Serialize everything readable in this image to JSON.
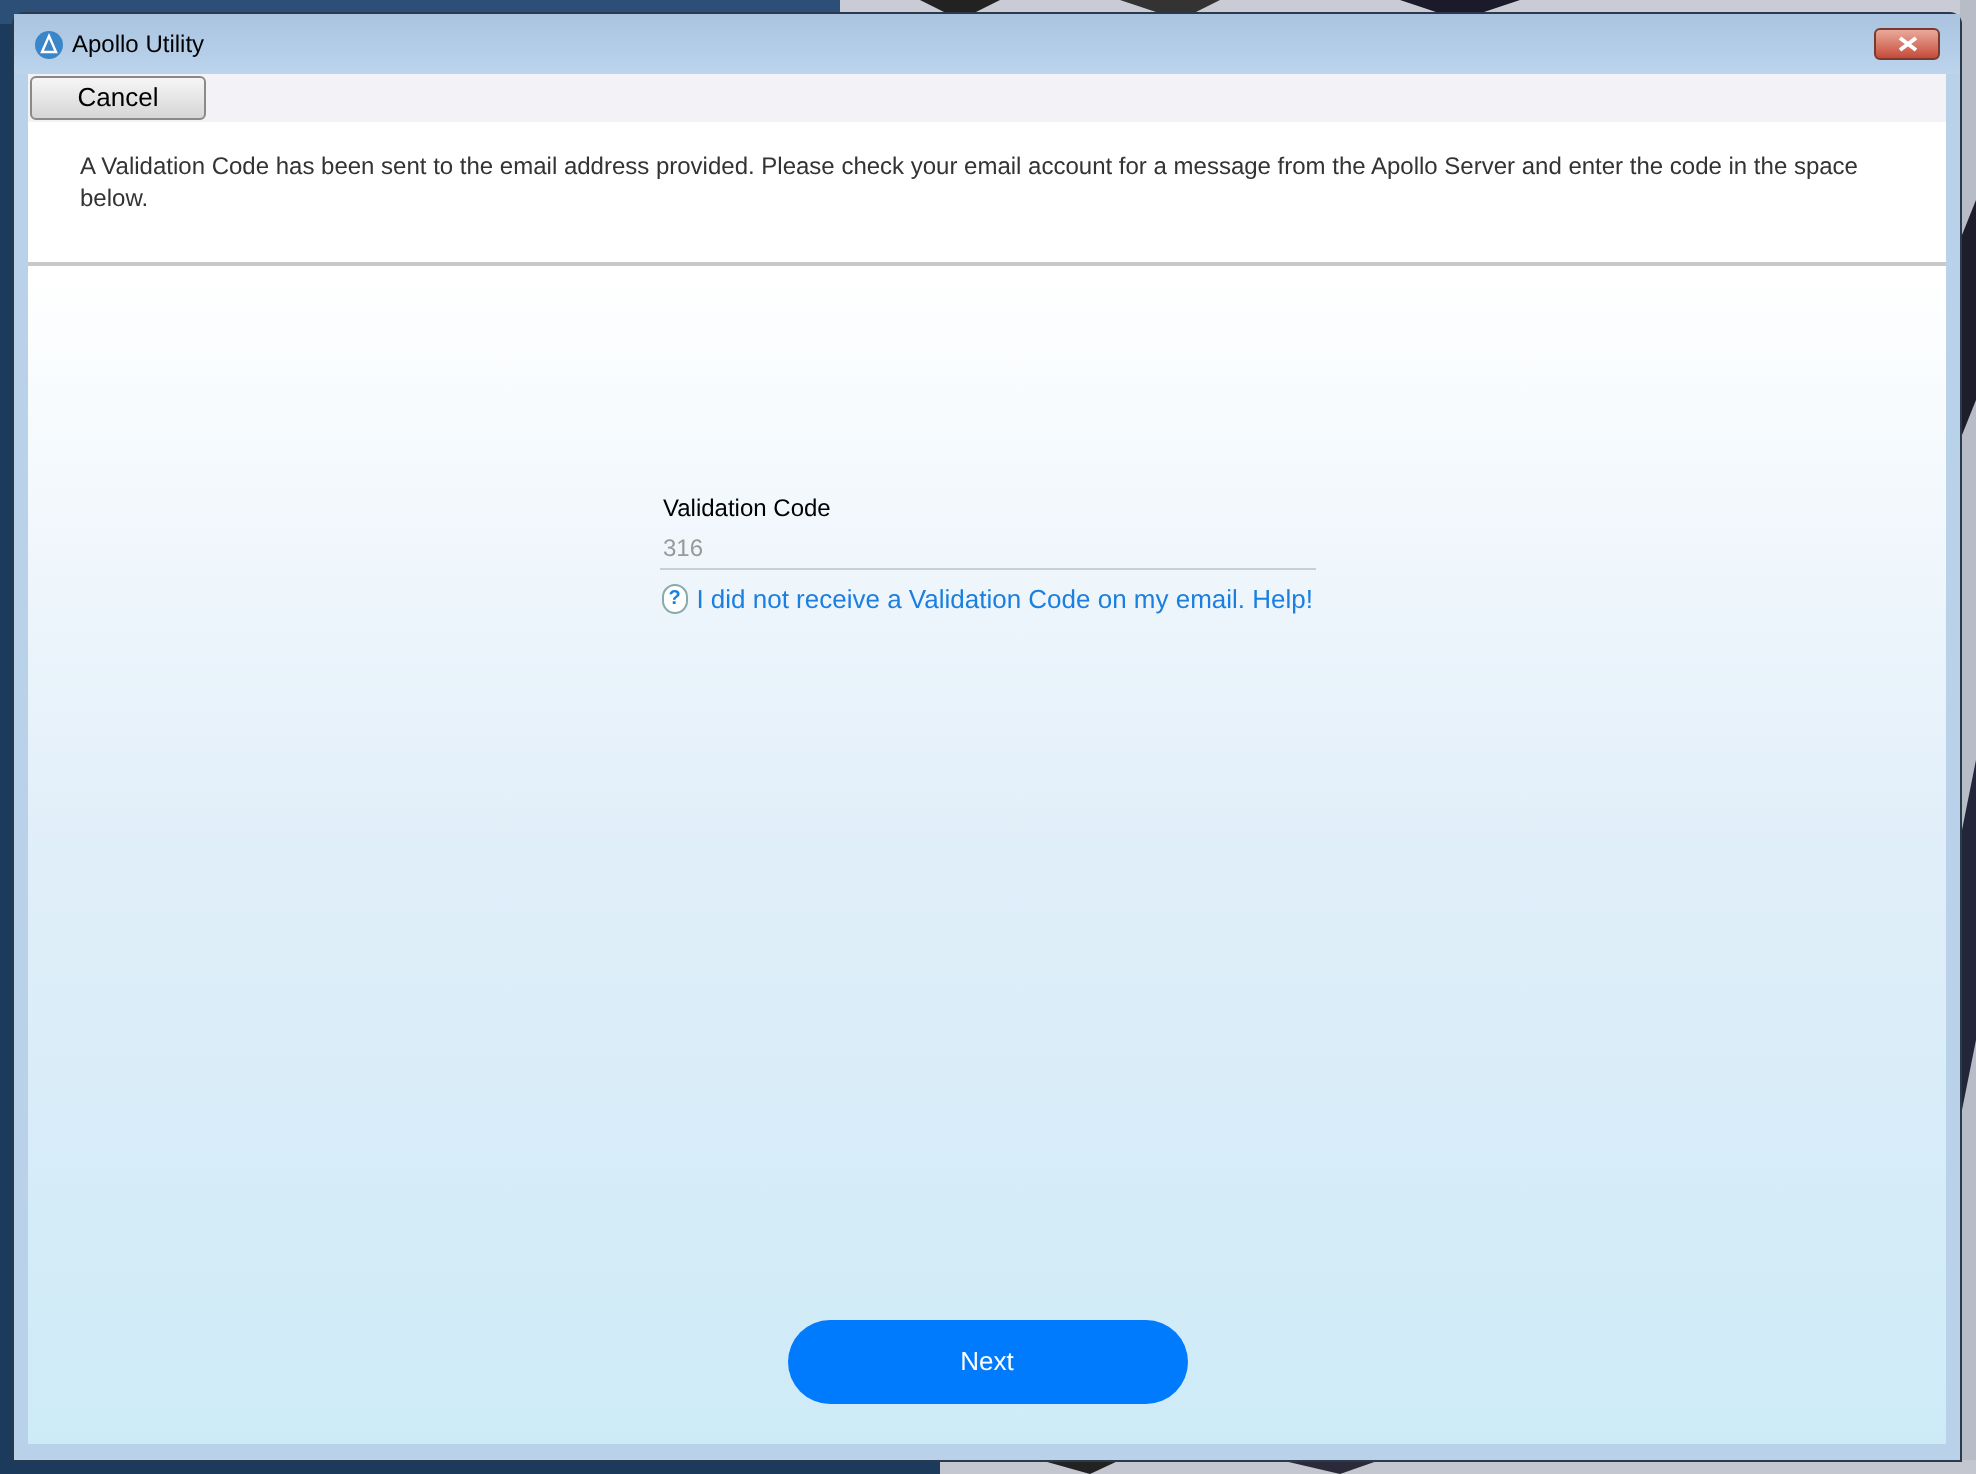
{
  "window": {
    "title": "Apollo Utility"
  },
  "toolbar": {
    "cancel_button": "Cancel"
  },
  "message": "A Validation Code has been sent to the email address provided. Please check your email account for a message from the Apollo Server and enter the code in the space below.",
  "form": {
    "label": "Validation Code",
    "placeholder": "316",
    "help_icon": "?",
    "help_link": "I did not receive a Validation Code on my email. Help!"
  },
  "next_button": "Next"
}
